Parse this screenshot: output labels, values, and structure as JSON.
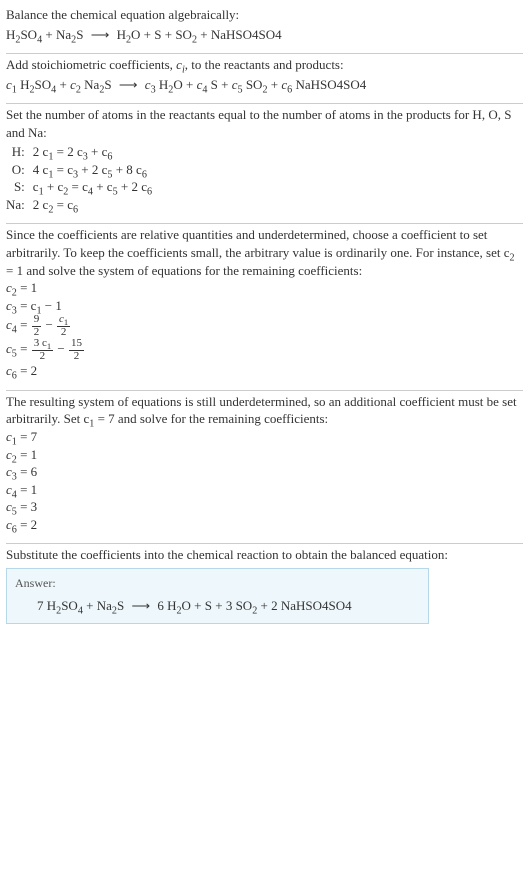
{
  "intro": {
    "line1": "Balance the chemical equation algebraically:",
    "lhs1": "H",
    "lhs2": "SO",
    "lhs3": " + Na",
    "lhs4": "S",
    "arrow": "⟶",
    "rhs1": "H",
    "rhs2": "O + S + SO",
    "rhs3": " + NaHSO4SO4"
  },
  "stoich": {
    "text": "Add stoichiometric coefficients, ",
    "text2": ", to the reactants and products:",
    "c": "c",
    "i": "i",
    "parts": {
      "p1": " H",
      "p2": "SO",
      "p3": " + ",
      "p4": " Na",
      "p5": "S",
      "p6": " H",
      "p7": "O + ",
      "p8": " S + ",
      "p9": " SO",
      "p10": " + ",
      "p11": " NaHSO4SO4"
    },
    "idx": {
      "c1": "1",
      "c2": "2",
      "c3": "3",
      "c4": "4",
      "c5": "5",
      "c6": "6"
    }
  },
  "atoms": {
    "text1": "Set the number of atoms in the reactants equal to the number of atoms in the products for H, O, S and Na:",
    "rows": [
      {
        "label": "H:",
        "lhs": "2 c",
        "l1": "1",
        "eq": " = 2 c",
        "r1": "3",
        "plus": " + c",
        "r2": "6"
      },
      {
        "label": "O:",
        "lhs": "4 c",
        "l1": "1",
        "eq": " = c",
        "r1": "3",
        "plus": " + 2 c",
        "r2": "5",
        "plus2": " + 8 c",
        "r3": "6"
      },
      {
        "label": "S:",
        "lhs": "c",
        "l1": "1",
        "eq": " + c",
        "r1": "2",
        "plus": " = c",
        "r2": "4",
        "plus2": " + c",
        "r3": "5",
        "plus3": " + 2 c",
        "r4": "6"
      },
      {
        "label": "Na:",
        "lhs": "2 c",
        "l1": "2",
        "eq": " = c",
        "r1": "6"
      }
    ]
  },
  "underdet": {
    "text": "Since the coefficients are relative quantities and underdetermined, choose a coefficient to set arbitrarily. To keep the coefficients small, the arbitrary value is ordinarily one. For instance, set c",
    "sub": "2",
    "text2": " = 1 and solve the system of equations for the remaining coefficients:",
    "lines": {
      "l1a": "c",
      "l1b": "2",
      "l1c": " = 1",
      "l2a": "c",
      "l2b": "3",
      "l2c": " = c",
      "l2d": "1",
      "l2e": " − 1",
      "l3a": "c",
      "l3b": "4",
      "l3c": " = ",
      "l4a": "c",
      "l4b": "5",
      "l4c": " = ",
      "l5a": "c",
      "l5b": "6",
      "l5c": " = 2"
    },
    "frac": {
      "n1": "9",
      "d1": "2",
      "minus": " − ",
      "nc": "c",
      "ns": "1",
      "d2": "2",
      "n3": "3 c",
      "n3s": "1",
      "d3": "2",
      "n4": "15",
      "d4": "2"
    }
  },
  "second": {
    "text": "The resulting system of equations is still underdetermined, so an additional coefficient must be set arbitrarily. Set c",
    "sub": "1",
    "text2": " = 7 and solve for the remaining coefficients:",
    "lines": [
      {
        "c": "c",
        "i": "1",
        "v": " = 7"
      },
      {
        "c": "c",
        "i": "2",
        "v": " = 1"
      },
      {
        "c": "c",
        "i": "3",
        "v": " = 6"
      },
      {
        "c": "c",
        "i": "4",
        "v": " = 1"
      },
      {
        "c": "c",
        "i": "5",
        "v": " = 3"
      },
      {
        "c": "c",
        "i": "6",
        "v": " = 2"
      }
    ]
  },
  "subst": {
    "text": "Substitute the coefficients into the chemical reaction to obtain the balanced equation:"
  },
  "answer": {
    "label": "Answer:",
    "eq": {
      "a": "7 H",
      "b": "SO",
      "c": " + Na",
      "d": "S",
      "arr": "⟶",
      "e": "6 H",
      "f": "O + S + 3 SO",
      "g": " + 2 NaHSO4SO4"
    }
  }
}
